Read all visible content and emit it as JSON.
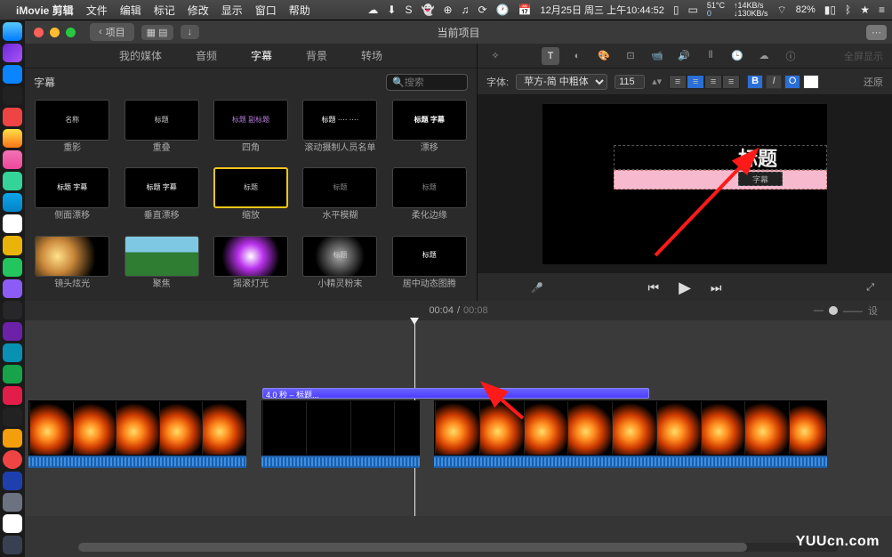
{
  "menubar": {
    "app": "iMovie 剪辑",
    "items": [
      "文件",
      "编辑",
      "标记",
      "修改",
      "显示",
      "窗口",
      "帮助"
    ],
    "date": "12月25日 周三 上午10:44:52",
    "temp": "51°C",
    "net_up": "↑14KB/s",
    "net_down": "↓130KB/s",
    "battery": "82%"
  },
  "titlebar": {
    "back": "项目",
    "title": "当前项目"
  },
  "tabs": {
    "items": [
      "我的媒体",
      "音频",
      "字幕",
      "背景",
      "转场"
    ],
    "active": 2
  },
  "section_label": "字幕",
  "search": {
    "placeholder": "搜索"
  },
  "tiles": [
    {
      "label": "重影",
      "txt": "名称"
    },
    {
      "label": "重叠",
      "txt": "标题"
    },
    {
      "label": "四角",
      "txt": "标题\n副标题"
    },
    {
      "label": "滚动摄制人员名单",
      "txt": "标题\n····\n····"
    },
    {
      "label": "漂移",
      "txt": "标题\n字幕"
    },
    {
      "label": "侧面漂移",
      "txt": "标题\n字幕"
    },
    {
      "label": "垂直漂移",
      "txt": "标题 字幕"
    },
    {
      "label": "缩放",
      "txt": "标题",
      "sel": true
    },
    {
      "label": "水平模糊",
      "txt": "标题"
    },
    {
      "label": "柔化边缘",
      "txt": "标题"
    },
    {
      "label": "镜头炫光",
      "txt": ""
    },
    {
      "label": "聚焦",
      "txt": ""
    },
    {
      "label": "摇滚灯光",
      "txt": ""
    },
    {
      "label": "小精灵粉末",
      "txt": "标题"
    },
    {
      "label": "居中动态图腾",
      "txt": "标题"
    }
  ],
  "toolbar_icons": [
    "wand",
    "",
    "T",
    "circle-half",
    "palette",
    "crop",
    "video",
    "volume",
    "eq",
    "clock",
    "cloud",
    "info"
  ],
  "format": {
    "label": "字体:",
    "font": "苹方-简 中粗体",
    "size": "115",
    "bold": "B",
    "italic": "I",
    "outline": "O",
    "reset": "还原"
  },
  "viewer": {
    "title_text": "标题",
    "subtitle_text": "字幕"
  },
  "time": {
    "current": "00:04",
    "total": "00:08"
  },
  "title_clip": {
    "text": "4.0 秒 – 标题..."
  },
  "watermark": "YUUcn.com"
}
